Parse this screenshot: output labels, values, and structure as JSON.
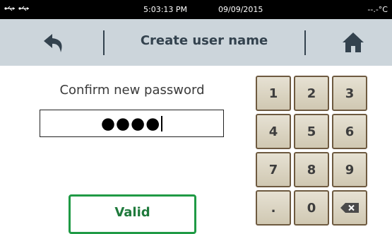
{
  "status_bar": {
    "time": "5:03:13 PM",
    "date": "09/09/2015",
    "temperature": "--.-°C",
    "icons": [
      "usb-icon",
      "usb-icon"
    ]
  },
  "header": {
    "title": "Create user name",
    "back_icon": "back-arrow-icon",
    "home_icon": "home-icon"
  },
  "form": {
    "prompt": "Confirm new password",
    "masked_value": "●●●●"
  },
  "valid_button": {
    "label": "Valid",
    "border_color": "#1f9a45"
  },
  "keypad": {
    "keys": [
      [
        "1",
        "2",
        "3"
      ],
      [
        "4",
        "5",
        "6"
      ],
      [
        "7",
        "8",
        "9"
      ],
      [
        ".",
        "0",
        "backspace"
      ]
    ],
    "backspace_icon": "backspace-icon"
  },
  "colors": {
    "header_bg": "#ccd5db",
    "header_text": "#33424e",
    "key_bg": "#ddd6c3",
    "key_border": "#6e5a40",
    "accent_green": "#1f9a45"
  }
}
